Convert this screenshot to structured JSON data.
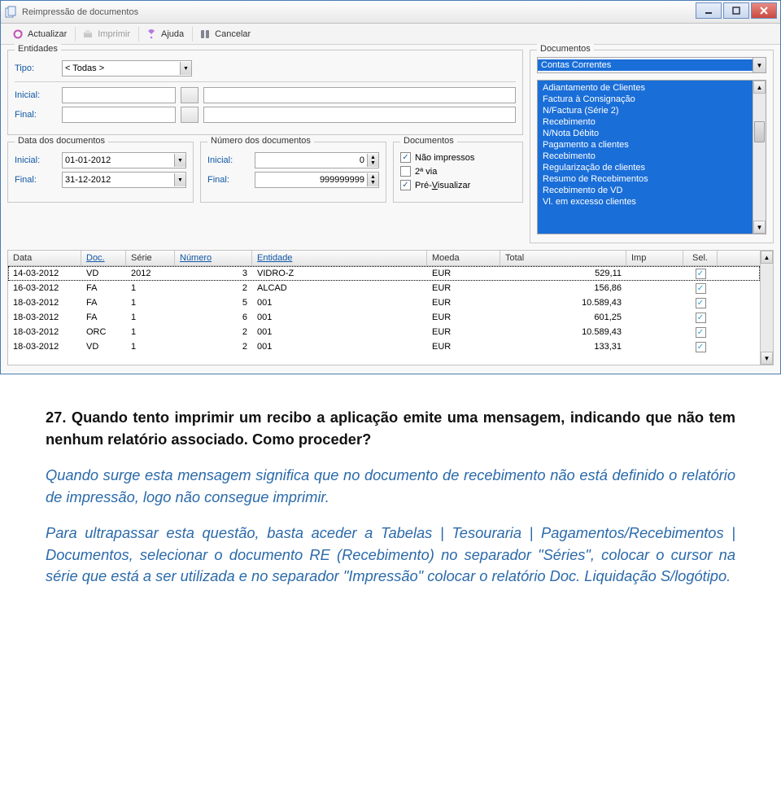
{
  "window": {
    "title": "Reimpressão de documentos"
  },
  "toolbar": {
    "refresh": "Actualizar",
    "print": "Imprimir",
    "help": "Ajuda",
    "cancel": "Cancelar"
  },
  "entidades": {
    "legend": "Entidades",
    "tipo_label": "Tipo:",
    "tipo_value": "< Todas >",
    "inicial_label": "Inicial:",
    "final_label": "Final:"
  },
  "sub": {
    "data": {
      "legend": "Data dos documentos",
      "inicial_label": "Inicial:",
      "final_label": "Final:",
      "inicial_value": "01-01-2012",
      "final_value": "31-12-2012"
    },
    "numero": {
      "legend": "Número dos documentos",
      "inicial_label": "Inicial:",
      "final_label": "Final:",
      "inicial_value": "0",
      "final_value": "999999999"
    },
    "docs": {
      "legend": "Documentos",
      "nao_impressos": "Não impressos",
      "segunda_via": "2ª via",
      "pre_visualizar": "Pré-Visualizar"
    }
  },
  "documentos": {
    "legend": "Documentos",
    "selected": "Contas Correntes",
    "list": [
      "Adiantamento de Clientes",
      "Factura à Consignação",
      "N/Factura (Série 2)",
      "Recebimento",
      "N/Nota Débito",
      "Pagamento a clientes",
      "Recebimento",
      "Regularização de clientes",
      "Resumo de Recebimentos",
      "Recebimento de VD",
      "Vl. em excesso clientes"
    ]
  },
  "table": {
    "headers": {
      "data": "Data",
      "doc": "Doc.",
      "serie": "Série",
      "numero": "Número",
      "entidade": "Entidade",
      "moeda": "Moeda",
      "total": "Total",
      "imp": "Imp",
      "sel": "Sel."
    },
    "rows": [
      {
        "data": "14-03-2012",
        "doc": "VD",
        "serie": "2012",
        "num": "3",
        "ent": "VIDRO-Z",
        "moeda": "EUR",
        "total": "529,11",
        "sel": true
      },
      {
        "data": "16-03-2012",
        "doc": "FA",
        "serie": "1",
        "num": "2",
        "ent": "ALCAD",
        "moeda": "EUR",
        "total": "156,86",
        "sel": true
      },
      {
        "data": "18-03-2012",
        "doc": "FA",
        "serie": "1",
        "num": "5",
        "ent": "001",
        "moeda": "EUR",
        "total": "10.589,43",
        "sel": true
      },
      {
        "data": "18-03-2012",
        "doc": "FA",
        "serie": "1",
        "num": "6",
        "ent": "001",
        "moeda": "EUR",
        "total": "601,25",
        "sel": true
      },
      {
        "data": "18-03-2012",
        "doc": "ORC",
        "serie": "1",
        "num": "2",
        "ent": "001",
        "moeda": "EUR",
        "total": "10.589,43",
        "sel": true
      },
      {
        "data": "18-03-2012",
        "doc": "VD",
        "serie": "1",
        "num": "2",
        "ent": "001",
        "moeda": "EUR",
        "total": "133,31",
        "sel": true
      }
    ]
  },
  "article": {
    "q_num": "27.",
    "q_text": "Quando tento imprimir um recibo a aplicação emite uma mensagem, indicando que não tem nenhum relatório associado. Como proceder?",
    "a1": "Quando surge esta mensagem significa que no documento de recebimento não está definido o relatório de impressão, logo não consegue imprimir.",
    "a2": "Para ultrapassar esta questão, basta aceder a Tabelas | Tesouraria | Pagamentos/Recebimentos | Documentos, selecionar o documento RE (Recebimento) no separador \"Séries\", colocar o cursor na série que está a ser utilizada e no separador \"Impressão\" colocar o relatório Doc. Liquidação S/logótipo."
  }
}
